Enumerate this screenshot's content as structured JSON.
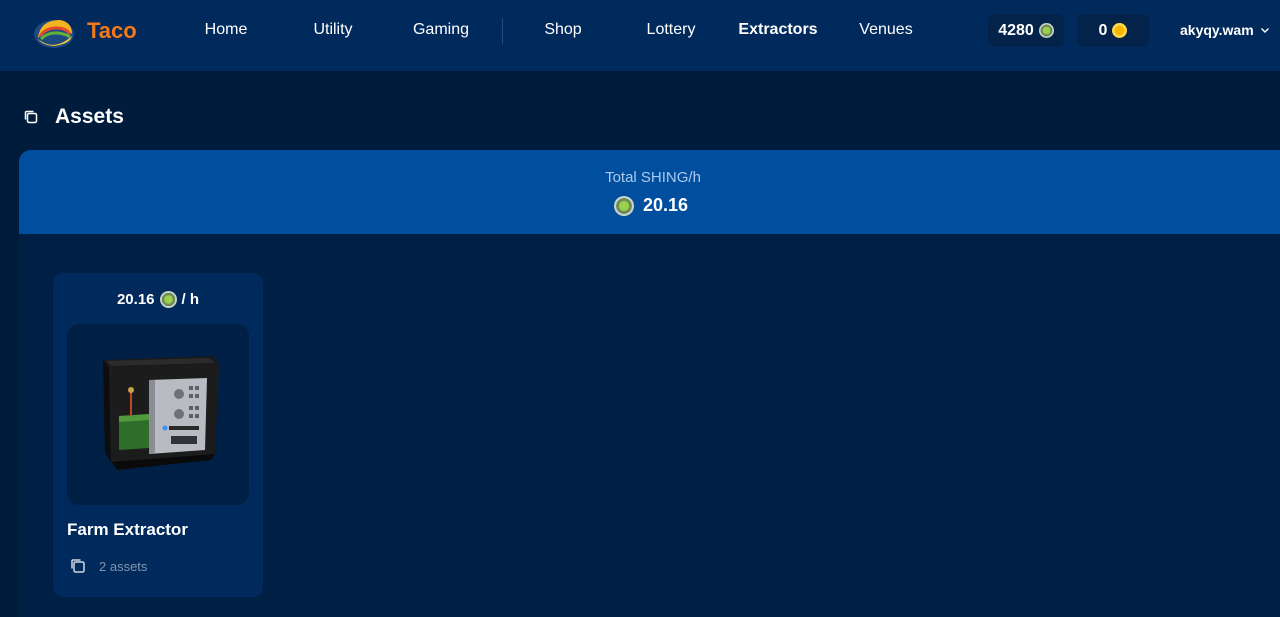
{
  "brand": {
    "name": "Taco",
    "color": "#f07a1a"
  },
  "nav": {
    "items": [
      {
        "label": "Home",
        "active": false
      },
      {
        "label": "Utility",
        "active": false
      },
      {
        "label": "Gaming",
        "active": false
      },
      {
        "label": "Shop",
        "active": false
      },
      {
        "label": "Lottery",
        "active": false
      },
      {
        "label": "Extractors",
        "active": true
      },
      {
        "label": "Venues",
        "active": false
      }
    ]
  },
  "balances": {
    "shing": {
      "value": "4280",
      "icon": "shing-coin-icon"
    },
    "taco": {
      "value": "0",
      "icon": "taco-coin-icon"
    }
  },
  "user": {
    "name": "akyqy.wam",
    "icon": "chevron-down-icon"
  },
  "page": {
    "title": "Assets",
    "icon": "copy-icon"
  },
  "summary": {
    "label": "Total SHING/h",
    "value": "20.16",
    "icon": "shing-coin-icon"
  },
  "cards": [
    {
      "rate": "20.16",
      "rate_unit": "/ h",
      "name": "Farm Extractor",
      "assets": "2 assets",
      "image": "farm-extractor-machine"
    }
  ],
  "colors": {
    "background": "#001c3d",
    "topbar": "#002a5c",
    "summary_band": "#004e9e",
    "card": "#002a5c"
  }
}
